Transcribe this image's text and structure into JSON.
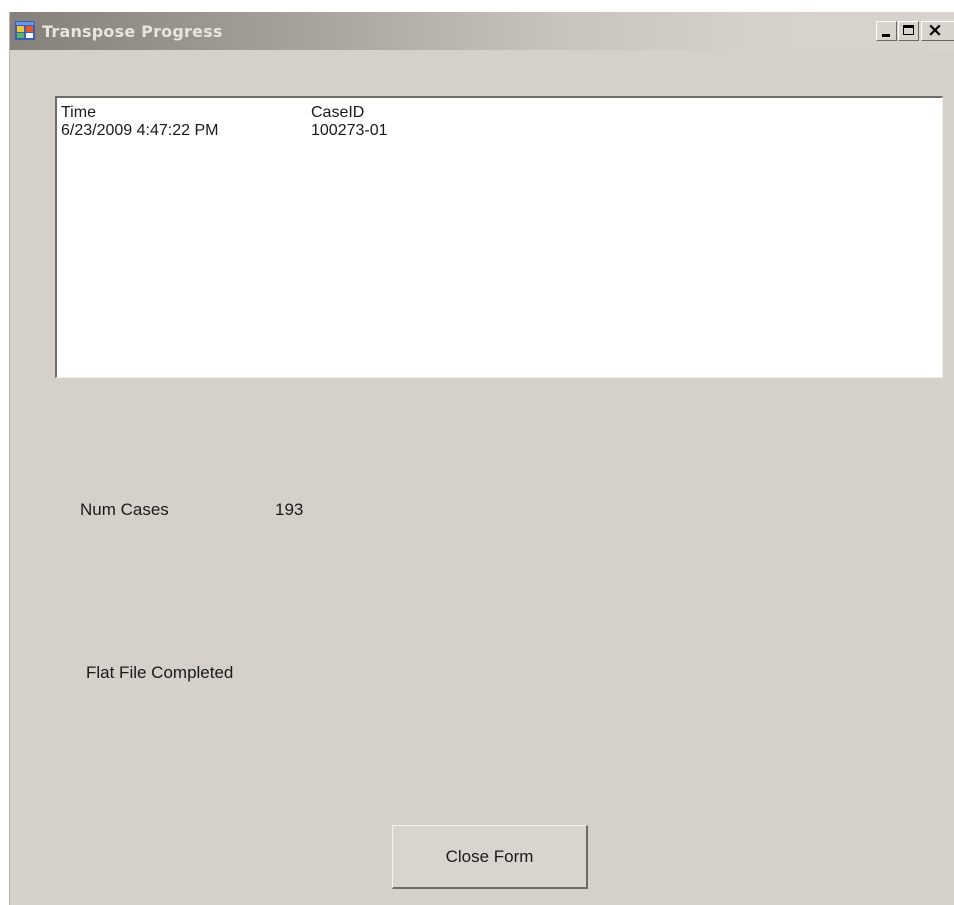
{
  "window": {
    "title": "Transpose Progress",
    "controls": {
      "minimize_icon": "minimize-icon",
      "maximize_icon": "maximize-icon",
      "close_glyph": "×"
    }
  },
  "log": {
    "columns": [
      "Time",
      "CaseID"
    ],
    "rows": [
      [
        "6/23/2009 4:47:22 PM",
        "100273-01"
      ]
    ]
  },
  "stats": {
    "num_cases_label": "Num Cases",
    "num_cases_value": "193"
  },
  "status": {
    "message": "Flat File Completed"
  },
  "buttons": {
    "close_form_label": "Close Form"
  },
  "colors": {
    "form_background": "#d5d0ca",
    "list_background": "#ffffff"
  }
}
